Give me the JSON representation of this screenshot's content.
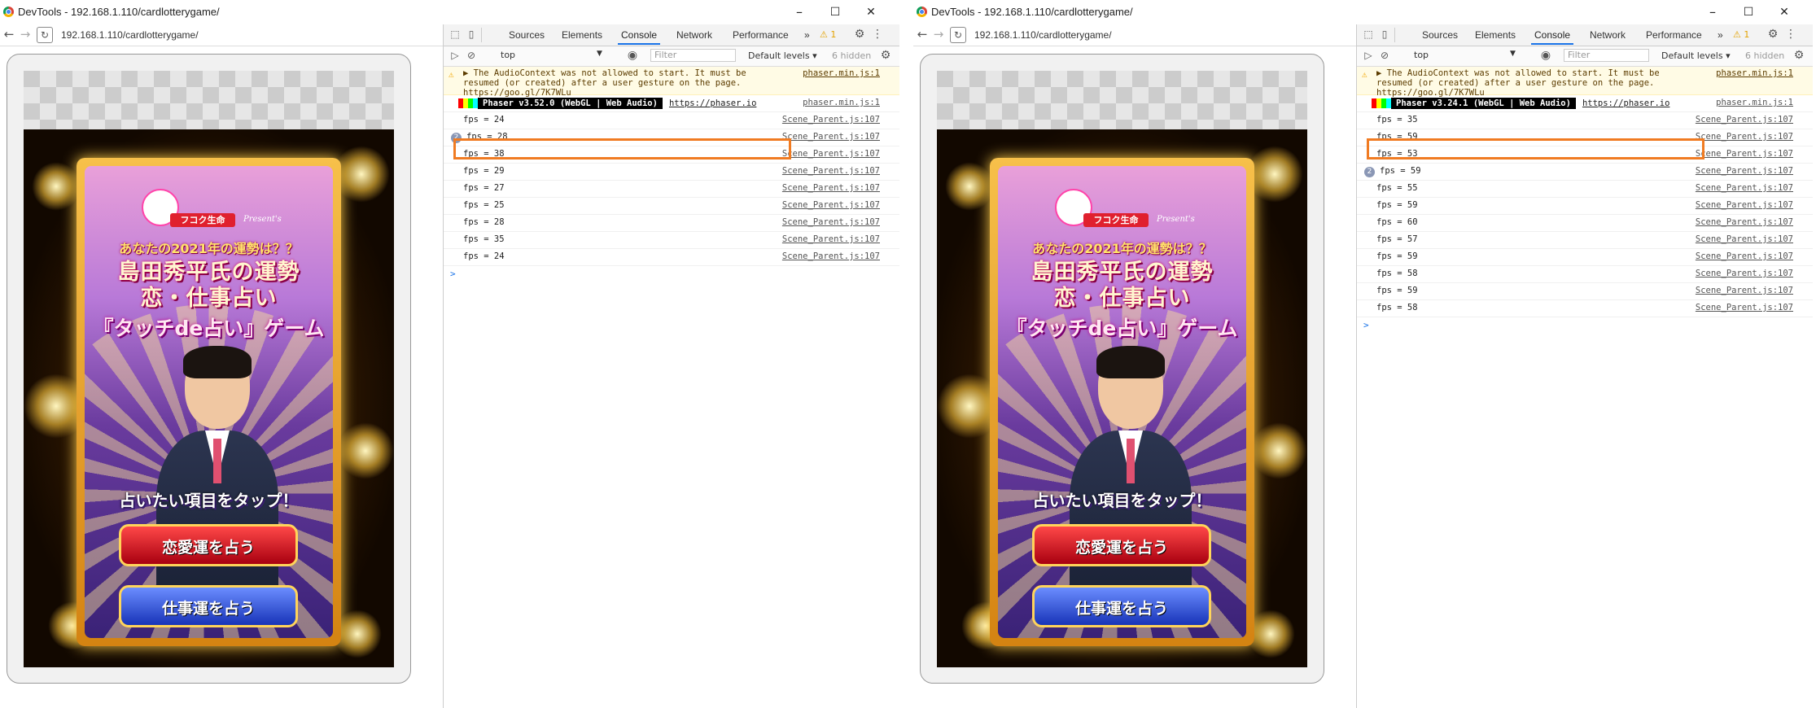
{
  "windows": [
    {
      "title": "DevTools - 192.168.1.110/cardlotterygame/",
      "url": "192.168.1.110/cardlotterygame/",
      "controls": {
        "minimize": "–",
        "maximize": "☐",
        "close": "✕"
      },
      "game": {
        "sponsor": "フコク生命",
        "presents": "Present's",
        "headline_small": "あなたの2021年の運勢は？？",
        "headline_main": "島田秀平氏の運勢",
        "headline_sub": "恋・仕事占い",
        "headline_game": "『タッチde占い』ゲーム",
        "prompt": "占いたい項目をタップ！",
        "button_love": "恋愛運を占う",
        "button_work": "仕事運を占う"
      },
      "devtools": {
        "tabs": [
          "Sources",
          "Elements",
          "Console",
          "Network",
          "Performance"
        ],
        "active_tab": "Console",
        "more": "»",
        "warning_count": "⚠ 1",
        "context": "top",
        "filter_placeholder": "Filter",
        "levels": "Default levels ▾",
        "hidden": "6 hidden",
        "warning_message": "▶ The AudioContext was not allowed to start. It must be resumed (or created) after a user gesture on the page. https://goo.gl/7K7WLu",
        "warning_source": "phaser.min.js:1",
        "phaser_label": "Phaser v3.52.0 (WebGL | Web Audio)",
        "phaser_url": "https://phaser.io",
        "phaser_source": "phaser.min.js:1",
        "logs": [
          {
            "count": "",
            "msg": "fps = 24",
            "src": "Scene_Parent.js:107"
          },
          {
            "count": "2",
            "msg": "fps = 28",
            "src": "Scene_Parent.js:107"
          },
          {
            "count": "",
            "msg": "fps = 38",
            "src": "Scene_Parent.js:107"
          },
          {
            "count": "",
            "msg": "fps = 29",
            "src": "Scene_Parent.js:107"
          },
          {
            "count": "",
            "msg": "fps = 27",
            "src": "Scene_Parent.js:107"
          },
          {
            "count": "",
            "msg": "fps = 25",
            "src": "Scene_Parent.js:107"
          },
          {
            "count": "",
            "msg": "fps = 28",
            "src": "Scene_Parent.js:107"
          },
          {
            "count": "",
            "msg": "fps = 35",
            "src": "Scene_Parent.js:107"
          },
          {
            "count": "",
            "msg": "fps = 24",
            "src": "Scene_Parent.js:107"
          }
        ],
        "prompt_caret": ">"
      }
    },
    {
      "title": "DevTools - 192.168.1.110/cardlotterygame/",
      "url": "192.168.1.110/cardlotterygame/",
      "controls": {
        "minimize": "–",
        "maximize": "☐",
        "close": "✕"
      },
      "game": {
        "sponsor": "フコク生命",
        "presents": "Present's",
        "headline_small": "あなたの2021年の運勢は？？",
        "headline_main": "島田秀平氏の運勢",
        "headline_sub": "恋・仕事占い",
        "headline_game": "『タッチde占い』ゲーム",
        "prompt": "占いたい項目をタップ！",
        "button_love": "恋愛運を占う",
        "button_work": "仕事運を占う"
      },
      "devtools": {
        "tabs": [
          "Sources",
          "Elements",
          "Console",
          "Network",
          "Performance"
        ],
        "active_tab": "Console",
        "more": "»",
        "warning_count": "⚠ 1",
        "context": "top",
        "filter_placeholder": "Filter",
        "levels": "Default levels ▾",
        "hidden": "6 hidden",
        "warning_message": "▶ The AudioContext was not allowed to start. It must be resumed (or created) after a user gesture on the page. https://goo.gl/7K7WLu",
        "warning_source": "phaser.min.js:1",
        "phaser_label": "Phaser v3.24.1 (WebGL | Web Audio)",
        "phaser_url": "https://phaser.io",
        "phaser_source": "phaser.min.js:1",
        "logs": [
          {
            "count": "",
            "msg": "fps = 35",
            "src": "Scene_Parent.js:107"
          },
          {
            "count": "",
            "msg": "fps = 59",
            "src": "Scene_Parent.js:107"
          },
          {
            "count": "",
            "msg": "fps = 53",
            "src": "Scene_Parent.js:107"
          },
          {
            "count": "2",
            "msg": "fps = 59",
            "src": "Scene_Parent.js:107"
          },
          {
            "count": "",
            "msg": "fps = 55",
            "src": "Scene_Parent.js:107"
          },
          {
            "count": "",
            "msg": "fps = 59",
            "src": "Scene_Parent.js:107"
          },
          {
            "count": "",
            "msg": "fps = 60",
            "src": "Scene_Parent.js:107"
          },
          {
            "count": "",
            "msg": "fps = 57",
            "src": "Scene_Parent.js:107"
          },
          {
            "count": "",
            "msg": "fps = 59",
            "src": "Scene_Parent.js:107"
          },
          {
            "count": "",
            "msg": "fps = 58",
            "src": "Scene_Parent.js:107"
          },
          {
            "count": "",
            "msg": "fps = 59",
            "src": "Scene_Parent.js:107"
          },
          {
            "count": "",
            "msg": "fps = 58",
            "src": "Scene_Parent.js:107"
          }
        ],
        "prompt_caret": ">"
      }
    }
  ],
  "colors": {
    "highlight": "#f07b22",
    "active_tab_underline": "#1a73e8",
    "warning_bg": "#fffbe5"
  }
}
